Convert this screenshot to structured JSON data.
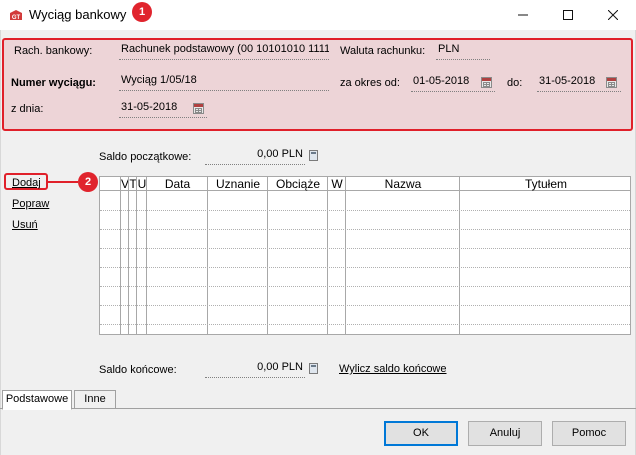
{
  "window": {
    "title": "Wyciąg bankowy",
    "controls": [
      "minimize-icon",
      "maximize-icon",
      "close-icon"
    ]
  },
  "callouts": [
    "1",
    "2"
  ],
  "header": {
    "account_label": "Rach. bankowy:",
    "account_value": "Rachunek podstawowy (00 10101010 1111",
    "currency_label": "Waluta rachunku:",
    "currency_value": "PLN",
    "statement_no_label": "Numer wyciągu:",
    "statement_no_value": "Wyciąg 1/05/18",
    "period_from_label": "za okres od:",
    "period_from_value": "01-05-2018",
    "period_to_label": "do:",
    "period_to_value": "31-05-2018",
    "date_label": "z dnia:",
    "date_value": "31-05-2018"
  },
  "opening_balance": {
    "label": "Saldo początkowe:",
    "value": "0,00 PLN"
  },
  "actions": {
    "add": "Dodaj",
    "edit": "Popraw",
    "delete": "Usuń"
  },
  "table": {
    "columns": [
      "V",
      "T",
      "U",
      "Data",
      "Uznanie",
      "Obciąże",
      "W",
      "Nazwa",
      "Tytułem"
    ],
    "rows": []
  },
  "closing_balance": {
    "label": "Saldo końcowe:",
    "value": "0,00 PLN",
    "calc_link": "Wylicz saldo końcowe"
  },
  "tabs": [
    {
      "label": "Podstawowe",
      "active": true
    },
    {
      "label": "Inne",
      "active": false
    }
  ],
  "buttons": {
    "ok": "OK",
    "cancel": "Anuluj",
    "help": "Pomoc"
  },
  "colors": {
    "highlight": "#e0202a",
    "default_button_border": "#0078d7"
  }
}
